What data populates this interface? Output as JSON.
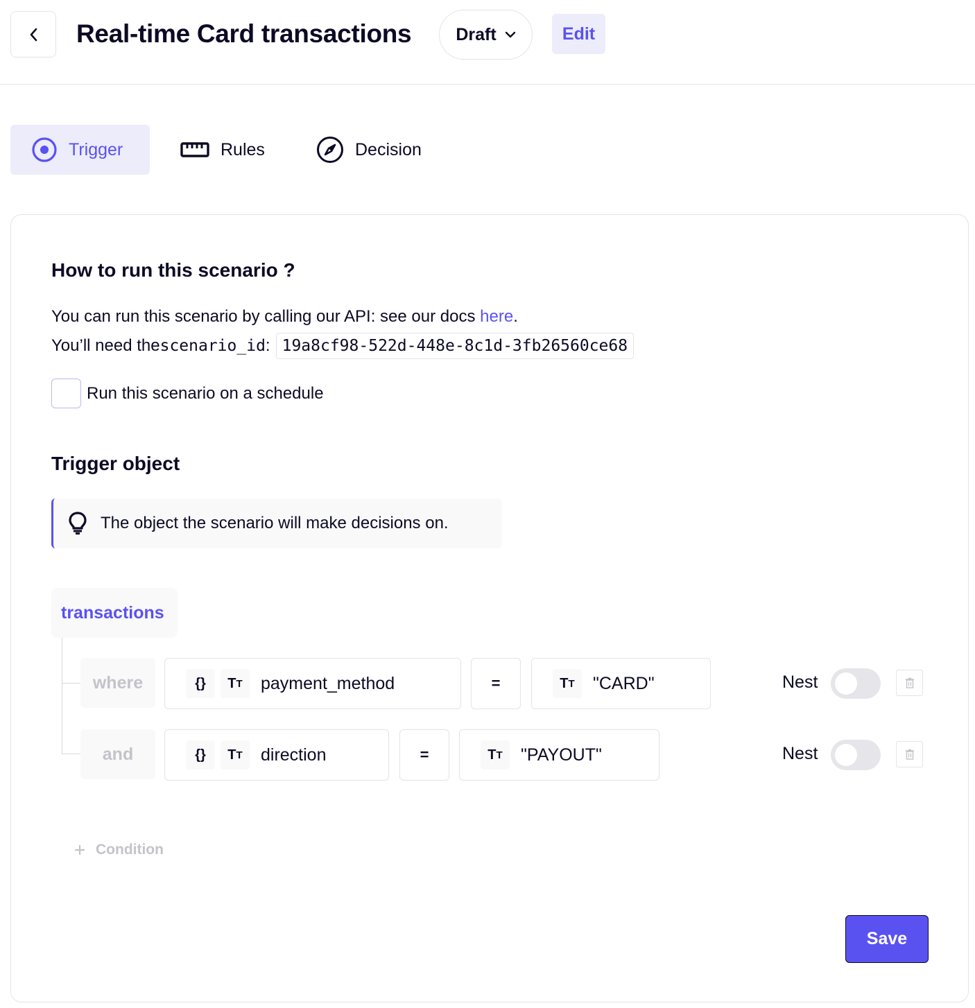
{
  "header": {
    "back_icon": "chevron-left-icon",
    "title": "Real-time Card transactions",
    "status": "Draft",
    "status_icon": "chevron-down-icon",
    "edit_label": "Edit"
  },
  "tabs": [
    {
      "label": "Trigger",
      "icon": "target-icon",
      "active": true
    },
    {
      "label": "Rules",
      "icon": "ruler-icon",
      "active": false
    },
    {
      "label": "Decision",
      "icon": "compass-icon",
      "active": false
    }
  ],
  "run_section": {
    "title": "How to run this scenario ?",
    "line1_prefix": "You can run this scenario by calling our API: see our docs ",
    "line1_link": "here",
    "line1_suffix": ".",
    "line2_prefix": "You’ll need the ",
    "line2_code": "scenario_id",
    "line2_colon": ":",
    "scenario_id": "19a8cf98-522d-448e-8c1d-3fb26560ce68",
    "schedule_label": "Run this scenario on a schedule",
    "schedule_checked": false
  },
  "trigger_section": {
    "title": "Trigger object",
    "callout_icon": "lightbulb-icon",
    "callout_text": "The object the scenario will make decisions on.",
    "object_name": "transactions",
    "conditions": [
      {
        "operator_label": "where",
        "field_icons": [
          "braces-icon",
          "text-type-icon"
        ],
        "field": "payment_method",
        "comparator": "=",
        "value_icon": "text-type-icon",
        "value": "\"CARD\"",
        "nest_label": "Nest",
        "nest_enabled": false
      },
      {
        "operator_label": "and",
        "field_icons": [
          "braces-icon",
          "text-type-icon"
        ],
        "field": "direction",
        "comparator": "=",
        "value_icon": "text-type-icon",
        "value": "\"PAYOUT\"",
        "nest_label": "Nest",
        "nest_enabled": false
      }
    ],
    "add_condition_label": "Condition"
  },
  "save_label": "Save",
  "colors": {
    "accent": "#5a52f0",
    "accent_bg": "#ececfb",
    "text": "#0c0a24",
    "muted": "#c3c3ca",
    "border": "#e4e4e8"
  }
}
